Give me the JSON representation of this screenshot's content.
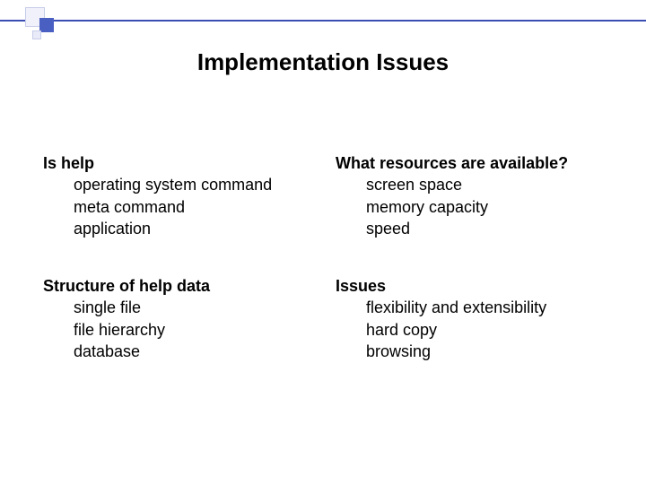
{
  "title": "Implementation Issues",
  "blocks": {
    "is_help": {
      "heading": "Is help",
      "items": [
        "operating system command",
        "meta command",
        "application"
      ]
    },
    "resources": {
      "heading": "What resources are available?",
      "items": [
        "screen space",
        "memory capacity",
        "speed"
      ]
    },
    "structure": {
      "heading": "Structure of help data",
      "items": [
        "single file",
        "file hierarchy",
        "database"
      ]
    },
    "issues": {
      "heading": "Issues",
      "items": [
        "flexibility and extensibility",
        "hard copy",
        "browsing"
      ]
    }
  }
}
